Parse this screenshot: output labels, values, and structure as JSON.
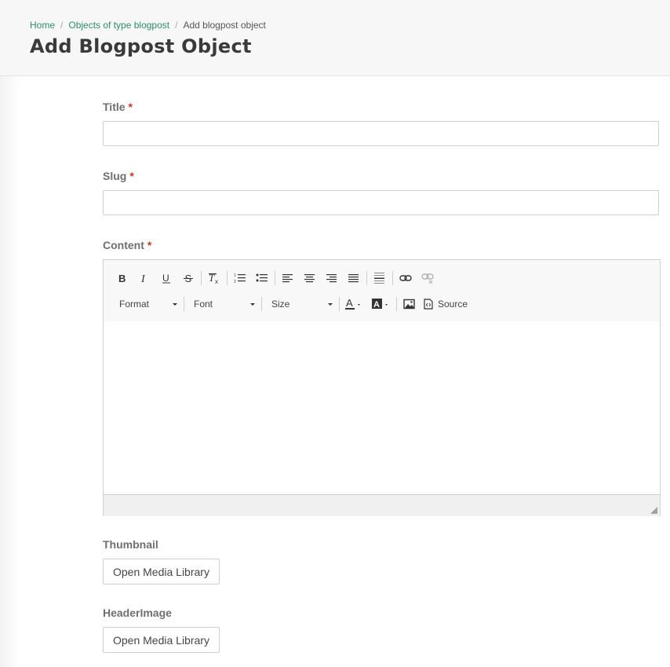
{
  "breadcrumb": {
    "home": "Home",
    "objects": "Objects of type blogpost",
    "current": "Add blogpost object"
  },
  "page_title": "Add Blogpost Object",
  "form": {
    "title": {
      "label": "Title",
      "required": "*",
      "value": ""
    },
    "slug": {
      "label": "Slug",
      "required": "*",
      "value": ""
    },
    "content": {
      "label": "Content",
      "required": "*"
    },
    "thumbnail": {
      "label": "Thumbnail",
      "button": "Open Media Library"
    },
    "header_image": {
      "label": "HeaderImage",
      "button": "Open Media Library"
    }
  },
  "editor": {
    "toolbar_row1": [
      "bold-icon",
      "italic-icon",
      "underline-icon",
      "strikethrough-icon",
      "remove-format-icon",
      "numbered-list-icon",
      "bulleted-list-icon",
      "align-left-icon",
      "align-center-icon",
      "align-right-icon",
      "justify-icon",
      "horizontal-line-icon",
      "link-icon",
      "unlink-icon"
    ],
    "format_label": "Format",
    "font_label": "Font",
    "size_label": "Size",
    "source_label": "Source",
    "accent_color": "#2e8b6a",
    "required_color": "#c0392b"
  }
}
